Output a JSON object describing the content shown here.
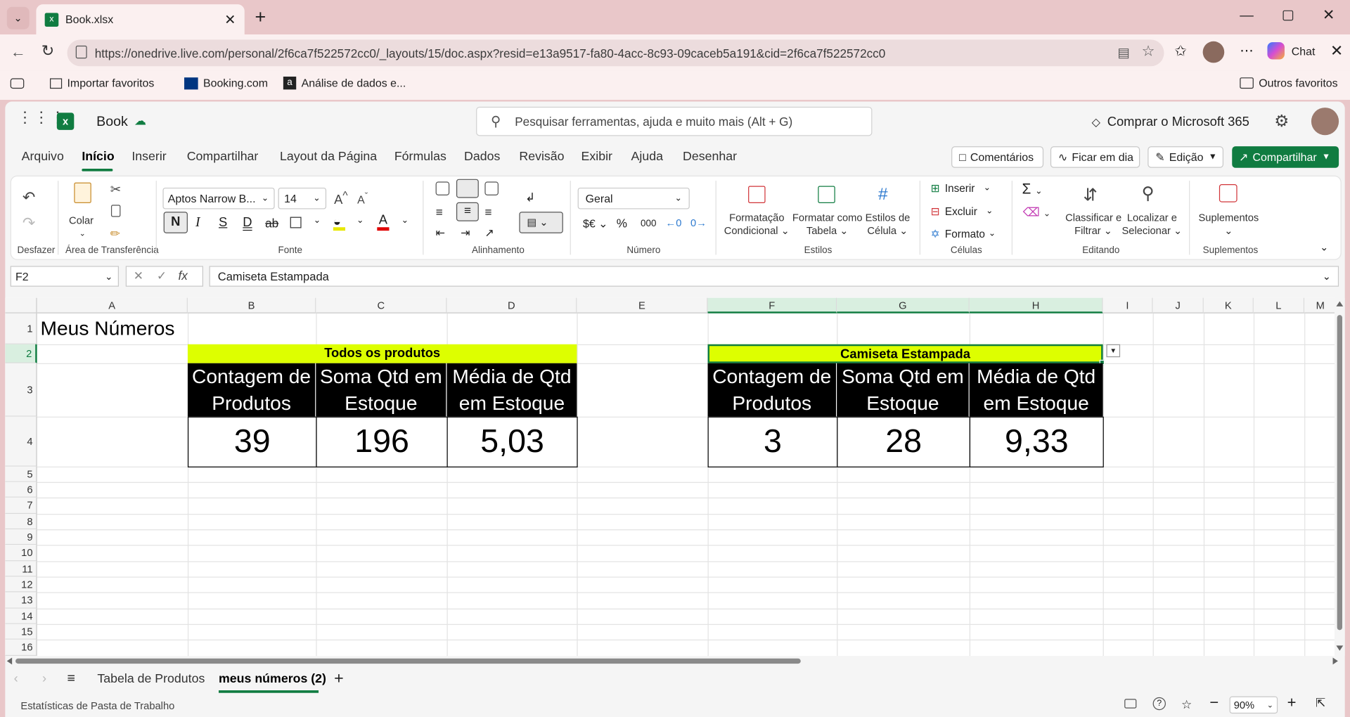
{
  "browser": {
    "tab_title": "Book.xlsx",
    "url": "https://onedrive.live.com/personal/2f6ca7f522572cc0/_layouts/15/doc.aspx?resid=e13a9517-fa80-4acc-8c93-09caceb5a191&cid=2f6ca7f522572cc0",
    "chat_label": "Chat",
    "favorites": [
      "Importar favoritos",
      "Booking.com",
      "Análise de dados e..."
    ],
    "other_favorites": "Outros favoritos"
  },
  "app": {
    "doc_name": "Book",
    "search_placeholder": "Pesquisar ferramentas, ajuda e muito mais (Alt + G)",
    "buy_label": "Comprar o Microsoft 365"
  },
  "menu": [
    "Arquivo",
    "Início",
    "Inserir",
    "Compartilhar",
    "Layout da Página",
    "Fórmulas",
    "Dados",
    "Revisão",
    "Exibir",
    "Ajuda",
    "Desenhar"
  ],
  "menu_right": {
    "comments": "Comentários",
    "catchup": "Ficar em dia",
    "editing": "Edição",
    "share": "Compartilhar"
  },
  "ribbon": {
    "undo_group": "Desfazer",
    "paste": "Colar",
    "clipboard_group": "Área de Transferência",
    "font_name": "Aptos Narrow B...",
    "font_size": "14",
    "font_group": "Fonte",
    "bold": "N",
    "italic": "I",
    "underline": "S",
    "dunder": "D",
    "strike": "ab",
    "align_group": "Alinhamento",
    "number_format": "Geral",
    "number_group": "Número",
    "cond_format": "Formatação\nCondicional",
    "cond_format_1": "Formatação",
    "cond_format_2": "Condicional",
    "fmt_table_1": "Formatar como",
    "fmt_table_2": "Tabela",
    "cell_styles_1": "Estilos de",
    "cell_styles_2": "Célula",
    "styles_group": "Estilos",
    "insert": "Inserir",
    "delete": "Excluir",
    "format": "Formato",
    "cells_group": "Células",
    "sort_1": "Classificar e",
    "sort_2": "Filtrar",
    "find_1": "Localizar e",
    "find_2": "Selecionar",
    "editing_group": "Editando",
    "addins": "Suplementos",
    "addins_group": "Suplementos"
  },
  "formula_bar": {
    "name_box": "F2",
    "content": "Camiseta Estampada"
  },
  "columns": [
    "A",
    "B",
    "C",
    "D",
    "E",
    "F",
    "G",
    "H",
    "I",
    "J",
    "K",
    "L",
    "M"
  ],
  "rows": [
    "1",
    "2",
    "3",
    "4",
    "5",
    "6",
    "7",
    "8",
    "9",
    "10",
    "11",
    "12",
    "13",
    "14",
    "15",
    "16"
  ],
  "sheet": {
    "title": "Meus Números",
    "table1": {
      "header": "Todos os produtos",
      "labels": [
        [
          "Contagem de",
          "Produtos"
        ],
        [
          "Soma Qtd em",
          "Estoque"
        ],
        [
          "Média de Qtd",
          "em Estoque"
        ]
      ],
      "values": [
        "39",
        "196",
        "5,03"
      ]
    },
    "table2": {
      "header": "Camiseta Estampada",
      "labels": [
        [
          "Contagem de",
          "Produtos"
        ],
        [
          "Soma Qtd em",
          "Estoque"
        ],
        [
          "Média de Qtd",
          "em Estoque"
        ]
      ],
      "values": [
        "3",
        "28",
        "9,33"
      ]
    }
  },
  "tabs": [
    "Tabela de Produtos",
    "meus números (2)"
  ],
  "status": {
    "left": "Estatísticas de Pasta de Trabalho",
    "zoom": "90%"
  }
}
